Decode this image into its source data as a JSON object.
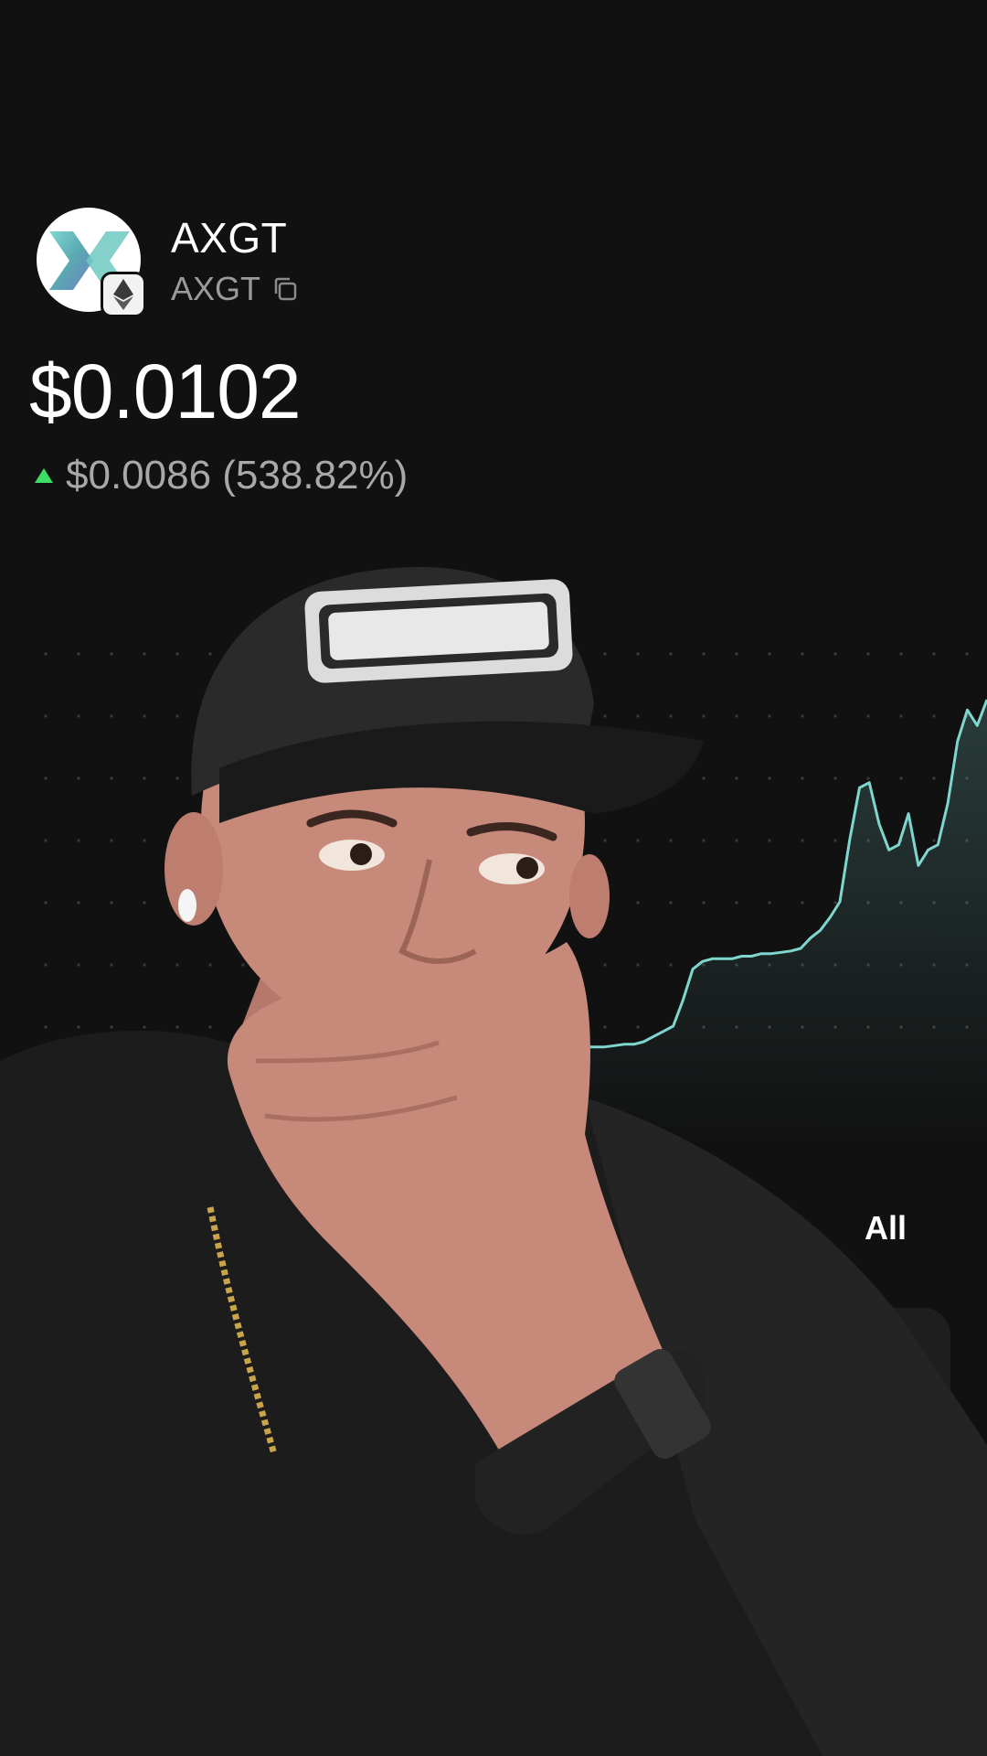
{
  "token": {
    "name": "AXGT",
    "symbol": "AXGT",
    "logo_icon": "axgt-x-logo-icon",
    "chain_icon": "ethereum-icon"
  },
  "price": {
    "value": "$0.0102",
    "change": "$0.0086 (538.82%)",
    "direction": "up",
    "up_color": "#3ddc65"
  },
  "chart_data": {
    "type": "area",
    "line_color": "#7fd6cf",
    "grid": "dotted",
    "values": [
      1.6,
      1.6,
      1.6,
      1.65,
      1.7,
      1.7,
      1.8,
      2.0,
      2.2,
      2.4,
      3.4,
      4.6,
      4.9,
      5.0,
      5.0,
      5.0,
      5.1,
      5.1,
      5.2,
      5.2,
      5.25,
      5.3,
      5.4,
      5.8,
      6.1,
      6.6,
      7.2,
      9.6,
      11.6,
      11.8,
      10.2,
      9.2,
      9.4,
      10.6,
      8.6,
      9.2,
      9.4,
      11.0,
      13.4,
      14.6,
      14.0,
      15.0
    ]
  },
  "time_range": {
    "selected": "All"
  }
}
